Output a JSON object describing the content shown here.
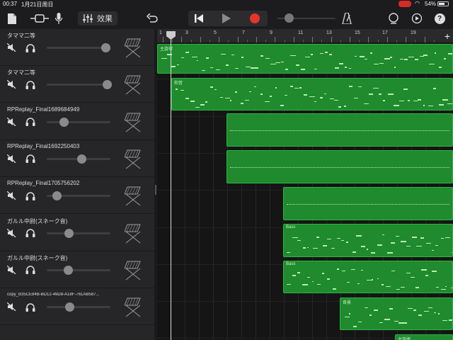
{
  "status": {
    "time": "00:37",
    "date": "1月21日周日",
    "battery": "54%"
  },
  "toolbar": {
    "fx_label": "效果"
  },
  "ruler": {
    "labels": [
      "1",
      "3",
      "5",
      "7",
      "9",
      "11",
      "13",
      "15",
      "17",
      "19"
    ]
  },
  "tracks": [
    {
      "name": "タママ二等",
      "volume": 0.92
    },
    {
      "name": "タママ二等",
      "volume": 0.94
    },
    {
      "name": "RPReplay_Final1689684949",
      "volume": 0.27
    },
    {
      "name": "RPReplay_Final1692250403",
      "volume": 0.54
    },
    {
      "name": "RPReplay_Final1705756202",
      "volume": 0.15
    },
    {
      "name": "ガルル中尉(スネーク音)",
      "volume": 0.34
    },
    {
      "name": "ガルル中尉(スネーク音)",
      "volume": 0.33
    },
    {
      "name": "copy_B35CE84B-BD12-49D8-A18F-761AB587...",
      "volume": 0.35
    }
  ],
  "regions": [
    {
      "track": 0,
      "label": "主旋律"
    },
    {
      "track": 1,
      "label": "和音"
    },
    {
      "track": 2,
      "label": ""
    },
    {
      "track": 3,
      "label": ""
    },
    {
      "track": 4,
      "label": ""
    },
    {
      "track": 5,
      "label": "Bass"
    },
    {
      "track": 6,
      "label": "Bass"
    },
    {
      "track": 7,
      "label": "背景"
    },
    {
      "track": 8,
      "label": "主旋律"
    }
  ],
  "colors": {
    "region": "#1f8a2e",
    "record": "#e5352b"
  },
  "icons": [
    "document-icon",
    "tracks-view-icon",
    "microphone-icon",
    "mixer-icon",
    "undo-icon",
    "rewind-icon",
    "play-icon",
    "record-icon",
    "metronome-icon",
    "loop-icon",
    "settings-icon",
    "help-icon",
    "mute-icon",
    "headphones-icon",
    "keyboard-icon",
    "add-track-icon"
  ]
}
